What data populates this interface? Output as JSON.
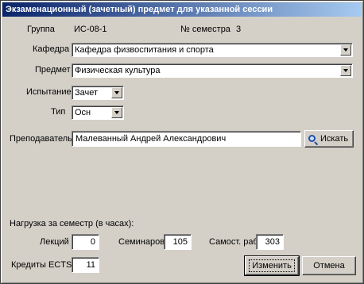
{
  "window": {
    "title": "Экзаменационный (зачетный) предмет для указанной сессии"
  },
  "info": {
    "group_label": "Группа",
    "group_value": "ИС-08-1",
    "semester_label": "№ семестра",
    "semester_value": "3"
  },
  "form": {
    "department_label": "Кафедра",
    "department_value": "Кафедра физвоспитания и спорта",
    "subject_label": "Предмет",
    "subject_value": "Физическая культура",
    "exam_label": "Испытание",
    "exam_value": "Зачет",
    "type_label": "Тип",
    "type_value": "Осн",
    "teacher_label": "Преподаватель",
    "teacher_value": "Малеванный Андрей Александрович",
    "search_button": "Искать"
  },
  "load": {
    "heading": "Нагрузка за семестр (в часах):",
    "lectures_label": "Лекций",
    "lectures_value": "0",
    "seminars_label": "Семинаров",
    "seminars_value": "105",
    "selfwork_label": "Самост. раб.",
    "selfwork_value": "303"
  },
  "credits": {
    "label": "Кредиты ECTS",
    "value": "11"
  },
  "buttons": {
    "change": "Изменить",
    "cancel": "Отмена"
  },
  "colors": {
    "title_start": "#0a246a",
    "title_end": "#a6caf0",
    "face": "#d4d0c8"
  }
}
